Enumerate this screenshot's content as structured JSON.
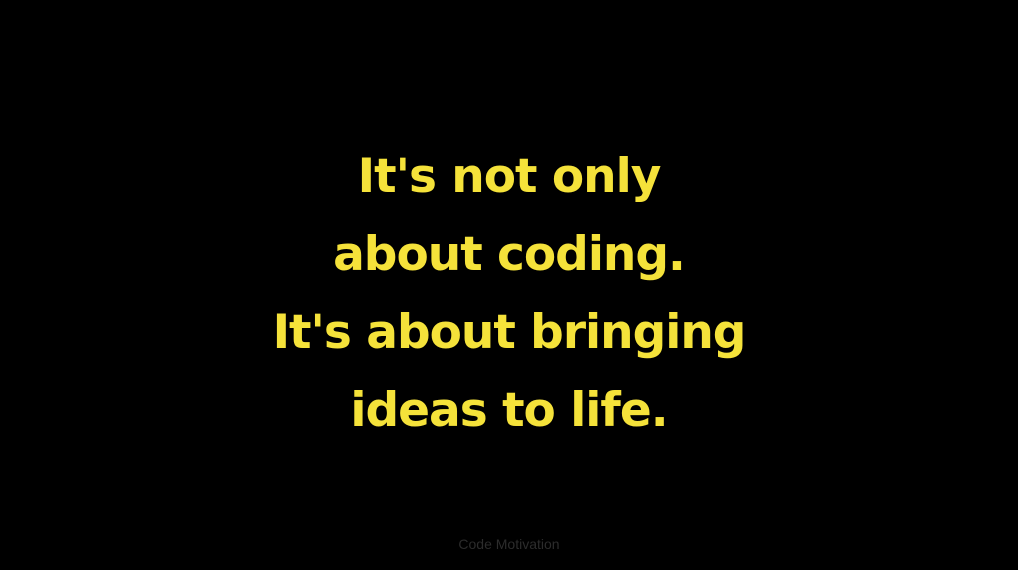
{
  "quote": {
    "lines": [
      "It's not only",
      "about coding.",
      "It's about bringing",
      "ideas to life."
    ]
  },
  "footer": {
    "watermark": "Code Motivation"
  },
  "colors": {
    "background": "#000000",
    "quote_text": "#f5e23a",
    "watermark_text": "#2c2c2c"
  }
}
